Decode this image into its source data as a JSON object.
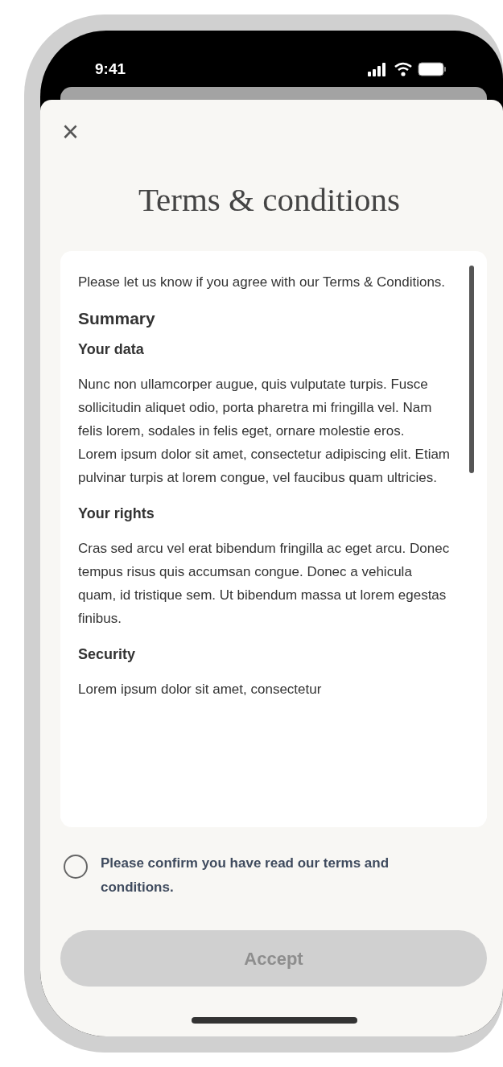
{
  "status_bar": {
    "time": "9:41"
  },
  "sheet": {
    "close": "×",
    "title": "Terms & conditions"
  },
  "terms": {
    "intro": "Please let us know if you agree with our Terms & Conditions.",
    "heading": "Summary",
    "sections": [
      {
        "heading": "Your data",
        "paragraphs": [
          "Nunc non ullamcorper augue, quis vulputate turpis.  Fusce sollicitudin aliquet odio, porta pharetra mi fringilla vel. Nam felis lorem, sodales in felis eget, ornare molestie eros.",
          "Lorem ipsum dolor sit amet, consectetur adipiscing elit. Etiam pulvinar turpis at lorem congue, vel faucibus quam ultricies."
        ]
      },
      {
        "heading": "Your rights",
        "paragraphs": [
          "Cras sed arcu vel erat bibendum fringilla ac eget arcu. Donec tempus risus quis accumsan congue. Donec a vehicula quam, id tristique sem. Ut bibendum massa ut lorem egestas finibus."
        ]
      },
      {
        "heading": "Security",
        "paragraphs": [
          "Lorem ipsum dolor sit amet, consectetur"
        ]
      }
    ]
  },
  "confirm": {
    "label": "Please confirm you have read our terms and conditions.",
    "checked": false
  },
  "accept_button": {
    "label": "Accept",
    "disabled": true
  }
}
